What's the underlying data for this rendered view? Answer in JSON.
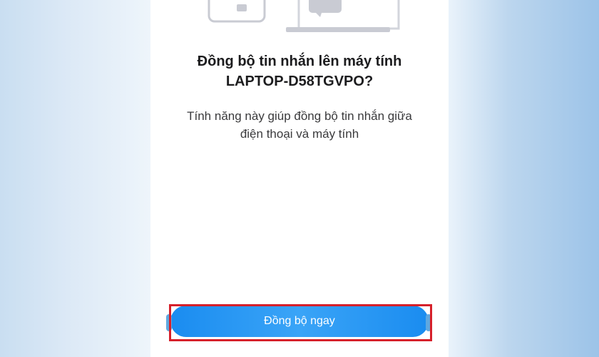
{
  "dialog": {
    "title_line1": "Đồng bộ tin nhắn lên máy tính",
    "title_line2": "LAPTOP-D58TGVPO?",
    "description_line1": "Tính năng này giúp đồng bộ tin nhắn giữa",
    "description_line2": "điện thoại và máy tính",
    "sync_button_label": "Đồng bộ ngay"
  },
  "colors": {
    "button": "#1a8cf0",
    "highlight": "#d6202a",
    "title_text": "#1c1c1e"
  },
  "icons": {
    "illustration": "phone-laptop-sync-illustration"
  }
}
